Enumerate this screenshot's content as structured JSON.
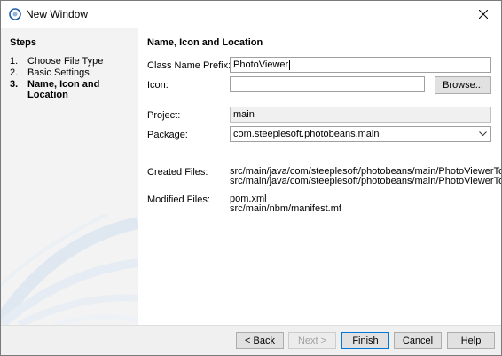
{
  "window": {
    "title": "New Window"
  },
  "steps": {
    "heading": "Steps",
    "items": [
      {
        "num": "1.",
        "label": "Choose File Type"
      },
      {
        "num": "2.",
        "label": "Basic Settings"
      },
      {
        "num": "3.",
        "label": "Name, Icon and Location"
      }
    ]
  },
  "main": {
    "heading": "Name, Icon and Location",
    "class_name_prefix": {
      "label": "Class Name Prefix:",
      "value": "PhotoViewer"
    },
    "icon": {
      "label": "Icon:",
      "value": "",
      "browse_label": "Browse..."
    },
    "project": {
      "label": "Project:",
      "value": "main"
    },
    "package": {
      "label": "Package:",
      "value": "com.steeplesoft.photobeans.main"
    },
    "created_files": {
      "label": "Created Files:",
      "lines": [
        "src/main/java/com/steeplesoft/photobeans/main/PhotoViewerTopComponent.java",
        "src/main/java/com/steeplesoft/photobeans/main/PhotoViewerTopComponent.form"
      ]
    },
    "modified_files": {
      "label": "Modified Files:",
      "lines": [
        "pom.xml",
        "src/main/nbm/manifest.mf"
      ]
    }
  },
  "footer": {
    "back": "< Back",
    "next": "Next >",
    "finish": "Finish",
    "cancel": "Cancel",
    "help": "Help"
  },
  "colors": {
    "focus_border": "#0078d7",
    "steps_bg": "#f3f3f3"
  }
}
